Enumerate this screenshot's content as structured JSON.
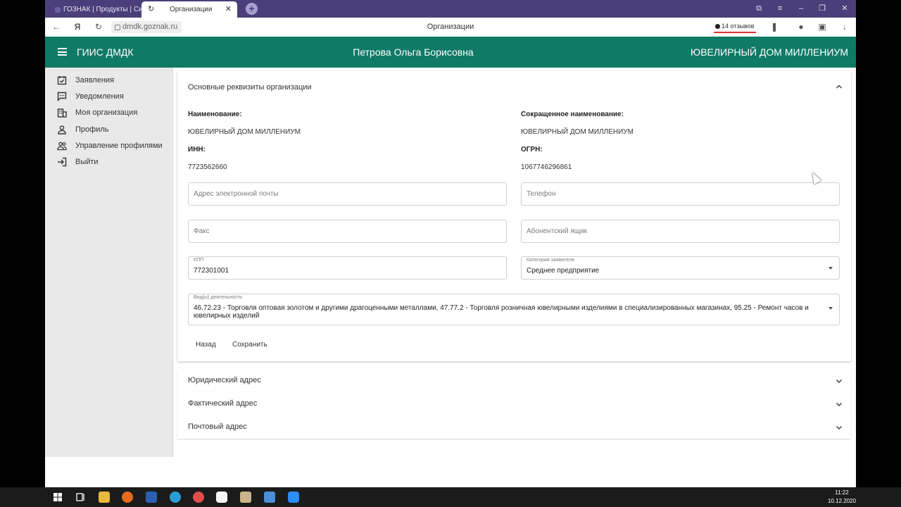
{
  "browser": {
    "tabs": [
      {
        "label": "ГОЗНАК | Продукты | Сис",
        "active": false
      },
      {
        "label": "Организации",
        "active": true
      }
    ],
    "url": "dmdk.goznak.ru",
    "page_title": "Организации",
    "reviews": "14 отзывов"
  },
  "header": {
    "app_title": "ГИИС ДМДК",
    "user_name": "Петрова Ольга Борисовна",
    "org_name": "ЮВЕЛИРНЫЙ ДОМ МИЛЛЕНИУМ",
    "bg_color": "#0f7a66"
  },
  "sidebar": {
    "items": [
      {
        "label": "Заявления",
        "icon": "calendar-check-icon"
      },
      {
        "label": "Уведомления",
        "icon": "message-icon"
      },
      {
        "label": "Моя организация",
        "icon": "building-icon"
      },
      {
        "label": "Профиль",
        "icon": "person-icon"
      },
      {
        "label": "Управление профилями",
        "icon": "people-icon"
      },
      {
        "label": "Выйти",
        "icon": "logout-icon"
      }
    ]
  },
  "main": {
    "section_title": "Основные реквизиты организации",
    "name_label": "Наименование:",
    "name_value": "ЮВЕЛИРНЫЙ ДОМ МИЛЛЕНИУМ",
    "short_name_label": "Сокращенное наименование:",
    "short_name_value": "ЮВЕЛИРНЫЙ ДОМ МИЛЛЕНИУМ",
    "inn_label": "ИНН:",
    "inn_value": "7723562660",
    "ogrn_label": "ОГРН:",
    "ogrn_value": "1067746296861",
    "email_placeholder": "Адрес электронной почты",
    "phone_placeholder": "Телефон",
    "fax_placeholder": "Факс",
    "pobox_placeholder": "Абонентский ящик",
    "kpp_label": "КПП",
    "kpp_value": "772301001",
    "category_label": "Категория заявителя",
    "category_value": "Среднее предприятие",
    "activity_label": "Вид(ы) деятельности",
    "activity_value": "46.72.23 - Торговля оптовая золотом и другими драгоценными металлами, 47.77.2 - Торговля розничная ювелирными изделиями в специализированных магазинах, 95.25 - Ремонт часов и ювелирных изделий",
    "back_label": "Назад",
    "save_label": "Сохранить"
  },
  "sections": [
    {
      "title": "Юридический адрес"
    },
    {
      "title": "Фактический адрес"
    },
    {
      "title": "Почтовый адрес"
    }
  ],
  "taskbar": {
    "time": "11:22",
    "date": "10.12.2020"
  }
}
